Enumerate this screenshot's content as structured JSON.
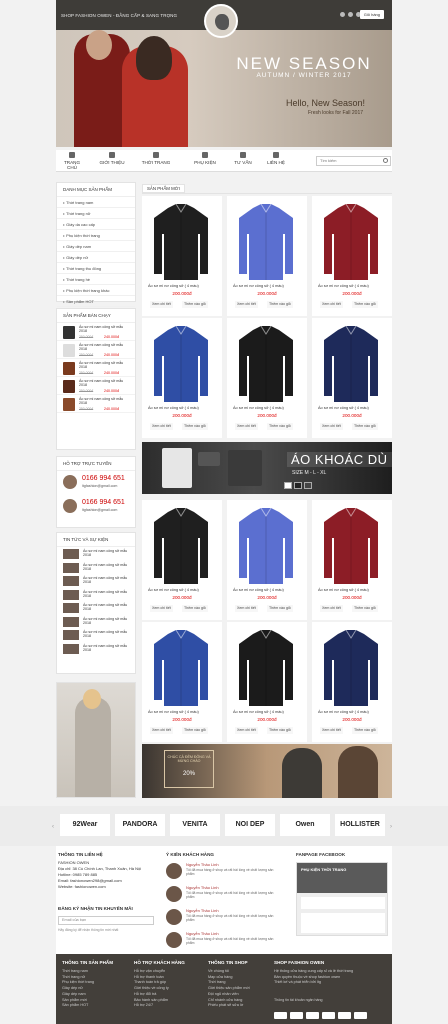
{
  "header": {
    "slogan": "SHOP FASHION OWEN - ĐẲNG CẤP & SANG TRỌNG",
    "cart": "Giỏ hàng"
  },
  "banner": {
    "title": "NEW SEASON",
    "subtitle": "AUTUMN / WINTER 2017",
    "hello": "Hello, New Season!",
    "fresh": "Fresh looks for Fall 2017"
  },
  "nav": {
    "items": [
      "TRANG CHỦ",
      "GIỚI THIỆU",
      "THỜI TRANG",
      "PHỤ KIỆN",
      "TƯ VẤN",
      "LIÊN HỆ"
    ],
    "search_placeholder": "Tìm kiếm"
  },
  "sidebar": {
    "categories_title": "DANH MỤC SẢN PHẨM",
    "categories": [
      "Thời trang nam",
      "Thời trang nữ",
      "Giày da cao cấp",
      "Phụ kiện thời trang",
      "Giày dép nam",
      "Giày dép nữ",
      "Thời trang thu đông",
      "Thời trang hè",
      "Phụ kiện thời trang khác",
      "Sản phẩm HOT"
    ],
    "bestseller_title": "SẢN PHẨM BÁN CHẠY",
    "bestsellers": [
      {
        "name": "Áo sơ mi nam công sở mẫu 2018",
        "old": "250.000đ",
        "new": "240.000đ"
      },
      {
        "name": "Áo sơ mi nam công sở mẫu 2018",
        "old": "250.000đ",
        "new": "240.000đ"
      },
      {
        "name": "Áo sơ mi nam công sở mẫu 2018",
        "old": "250.000đ",
        "new": "240.000đ"
      },
      {
        "name": "Áo sơ mi nam công sở mẫu 2018",
        "old": "250.000đ",
        "new": "240.000đ"
      },
      {
        "name": "Áo sơ mi nam công sở mẫu 2018",
        "old": "250.000đ",
        "new": "240.000đ"
      }
    ],
    "support_title": "HỖ TRỢ TRỰC TUYẾN",
    "support": [
      {
        "phone": "0166 994 651",
        "email": "ltgfashion@gmail.com"
      },
      {
        "phone": "0166 994 651",
        "email": "ltgfashion@gmail.com"
      }
    ],
    "news_title": "TIN TỨC VÀ SỰ KIỆN",
    "news": [
      "Áo sơ mi nam công sở mẫu 2018",
      "Áo sơ mi nam công sở mẫu 2018",
      "Áo sơ mi nam công sở mẫu 2018",
      "Áo sơ mi nam công sở mẫu 2018",
      "Áo sơ mi nam công sở mẫu 2018",
      "Áo sơ mi nam công sở mẫu 2018",
      "Áo sơ mi nam công sở mẫu 2018",
      "Áo sơ mi nam công sở mẫu 2018"
    ]
  },
  "products": {
    "section_title": "SẢN PHẨM MỚI",
    "name": "Áo sơ mi nơ công sở ( 4 màu)",
    "price": "200.000đ",
    "detail_btn": "Xem chi tiết",
    "cart_btn": "Thêm vào giỏ",
    "colors": [
      "#1f1f1f",
      "#5b6fd0",
      "#8c1d26",
      "#2f4ea5",
      "#1b1b1b",
      "#1e2a5a"
    ]
  },
  "promo": {
    "title": "ÁO KHOÁC DÙ",
    "size": "SIZE M - L - XL"
  },
  "promo2": {
    "text": "CHÚC CẢ ĐÊM ĐÔNG VÀ MỪNG CHÀO",
    "big": "20%"
  },
  "brands": [
    "92Wear",
    "PANDORA",
    "VENITA",
    "NOI DEP",
    "Owen",
    "HOLLISTER"
  ],
  "info": {
    "contact_title": "THÔNG TIN LIÊN HỆ",
    "company": "FASHION OWEN",
    "address": "Địa chỉ: 38 Cù Chính Lan, Thanh Xuân, Hà Nội",
    "hotline": "Hotline: 0985 789 885",
    "email": "Email: fashionowen298@gmail.com",
    "website": "Website: fashionowen.com",
    "newsletter_title": "ĐĂNG KÝ NHẬN TIN KHUYẾN MÃI",
    "email_placeholder": "Email của bạn",
    "newsletter_note": "Hãy đăng ký để nhận thông tin mới nhất",
    "testimonials_title": "Ý KIẾN KHÁCH HÀNG",
    "testimonials": [
      {
        "name": "Nguyễn Thảo Linh",
        "text": "Tôi đã mua hàng ở shop và rất hài lòng về chất lượng sản phẩm"
      },
      {
        "name": "Nguyễn Thảo Linh",
        "text": "Tôi đã mua hàng ở shop và rất hài lòng về chất lượng sản phẩm"
      },
      {
        "name": "Nguyễn Thảo Linh",
        "text": "Tôi đã mua hàng ở shop và rất hài lòng về chất lượng sản phẩm"
      },
      {
        "name": "Nguyễn Thảo Linh",
        "text": "Tôi đã mua hàng ở shop và rất hài lòng về chất lượng sản phẩm"
      }
    ],
    "fanpage_title": "FANPAGE FACEBOOK",
    "fanpage_name": "PHỤ KIỆN THỜI TRANG"
  },
  "footer": {
    "cols": [
      {
        "title": "THÔNG TIN SẢN PHẨM",
        "items": [
          "Thời trang nam",
          "Thời trang nữ",
          "Phụ kiện thời trang",
          "Giày dép nữ",
          "Giày dép nam",
          "Sản phẩm mới",
          "Sản phẩm HOT"
        ]
      },
      {
        "title": "HỖ TRỢ KHÁCH HÀNG",
        "items": [
          "Hỗ trợ vận chuyển",
          "Hỗ trợ thanh toán",
          "Thanh toán trả góp",
          "Giới thiệu về công ty",
          "Hỗ trợ đổi trả",
          "Bảo hành sản phẩm",
          "Hỗ trợ 24/7"
        ]
      },
      {
        "title": "THÔNG TIN SHOP",
        "items": [
          "Về chúng tôi",
          "Map cửa hàng",
          "Thời trang",
          "Giới thiệu sản phẩm mới",
          "Đội ngũ nhân viên",
          "Chỉ nhánh cửa hàng",
          "Phiếu phát sẽ sửa lớ"
        ]
      },
      {
        "title": "SHOP FASHION OWEN",
        "items": [
          "Hệ thống cửa hàng cung cấp sỉ và lẻ thời trang",
          "Bản quyền thuộc về shop fashion owen",
          "Thiết kế và phát triển bởi ltg"
        ]
      }
    ],
    "payment_title": "Thông tin tài khoản ngân hàng"
  }
}
